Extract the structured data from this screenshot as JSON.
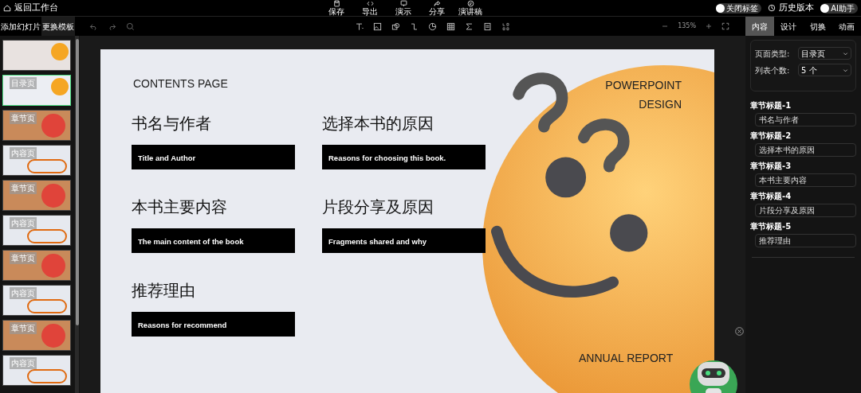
{
  "topbar": {
    "back": "返回工作台",
    "actions": [
      {
        "label": "保存",
        "kind": "save"
      },
      {
        "label": "导出",
        "kind": "export"
      },
      {
        "label": "演示",
        "kind": "present"
      },
      {
        "label": "分享",
        "kind": "share"
      },
      {
        "label": "演讲稿",
        "kind": "script"
      }
    ],
    "toggles_left": {
      "label": "关闭标签",
      "on": false
    },
    "history": "历史版本",
    "toggle_right": {
      "label": "AI助手",
      "on": false
    }
  },
  "left_panel": {
    "buttons": [
      "添加幻灯片",
      "更换模板"
    ],
    "thumbnails": [
      {
        "kind": "cover",
        "selected": false
      },
      {
        "kind": "contents",
        "label": "目录页",
        "selected": true
      },
      {
        "kind": "chapter",
        "label": "章节页",
        "selected": false
      },
      {
        "kind": "content",
        "label": "内容页",
        "selected": false
      },
      {
        "kind": "chapter",
        "label": "章节页",
        "selected": false
      },
      {
        "kind": "content",
        "label": "内容页",
        "selected": false
      },
      {
        "kind": "chapter",
        "label": "章节页",
        "selected": false
      },
      {
        "kind": "content",
        "label": "内容页",
        "selected": false
      },
      {
        "kind": "chapter",
        "label": "章节页",
        "selected": false
      },
      {
        "kind": "content",
        "label": "内容页",
        "selected": false
      }
    ]
  },
  "zoom": "135%",
  "slide": {
    "heading": "CONTENTS PAGE",
    "brand": [
      "POWERPOINT",
      "DESIGN"
    ],
    "footer": "ANNUAL REPORT",
    "items": [
      {
        "title": "书名与作者",
        "subtitle": "Title and Author"
      },
      {
        "title": "选择本书的原因",
        "subtitle": "Reasons for choosing this book."
      },
      {
        "title": "本书主要内容",
        "subtitle": "The main content of the book"
      },
      {
        "title": "片段分享及原因",
        "subtitle": "Fragments shared and why"
      },
      {
        "title": "推荐理由",
        "subtitle": "Reasons for recommend"
      }
    ]
  },
  "right_panel": {
    "tabs": [
      {
        "label": "内容",
        "selected": true
      },
      {
        "label": "设计",
        "selected": false
      },
      {
        "label": "切换",
        "selected": false
      },
      {
        "label": "动画",
        "selected": false
      }
    ],
    "settings": [
      {
        "label": "页面类型:",
        "value": "目录页"
      },
      {
        "label": "列表个数:",
        "value": "5 个"
      }
    ],
    "fields": [
      {
        "label": "章节标题-1",
        "value": "书名与作者"
      },
      {
        "label": "章节标题-2",
        "value": "选择本书的原因"
      },
      {
        "label": "章节标题-3",
        "value": "本书主要内容"
      },
      {
        "label": "章节标题-4",
        "value": "片段分享及原因"
      },
      {
        "label": "章节标题-5",
        "value": "推荐理由"
      }
    ]
  }
}
